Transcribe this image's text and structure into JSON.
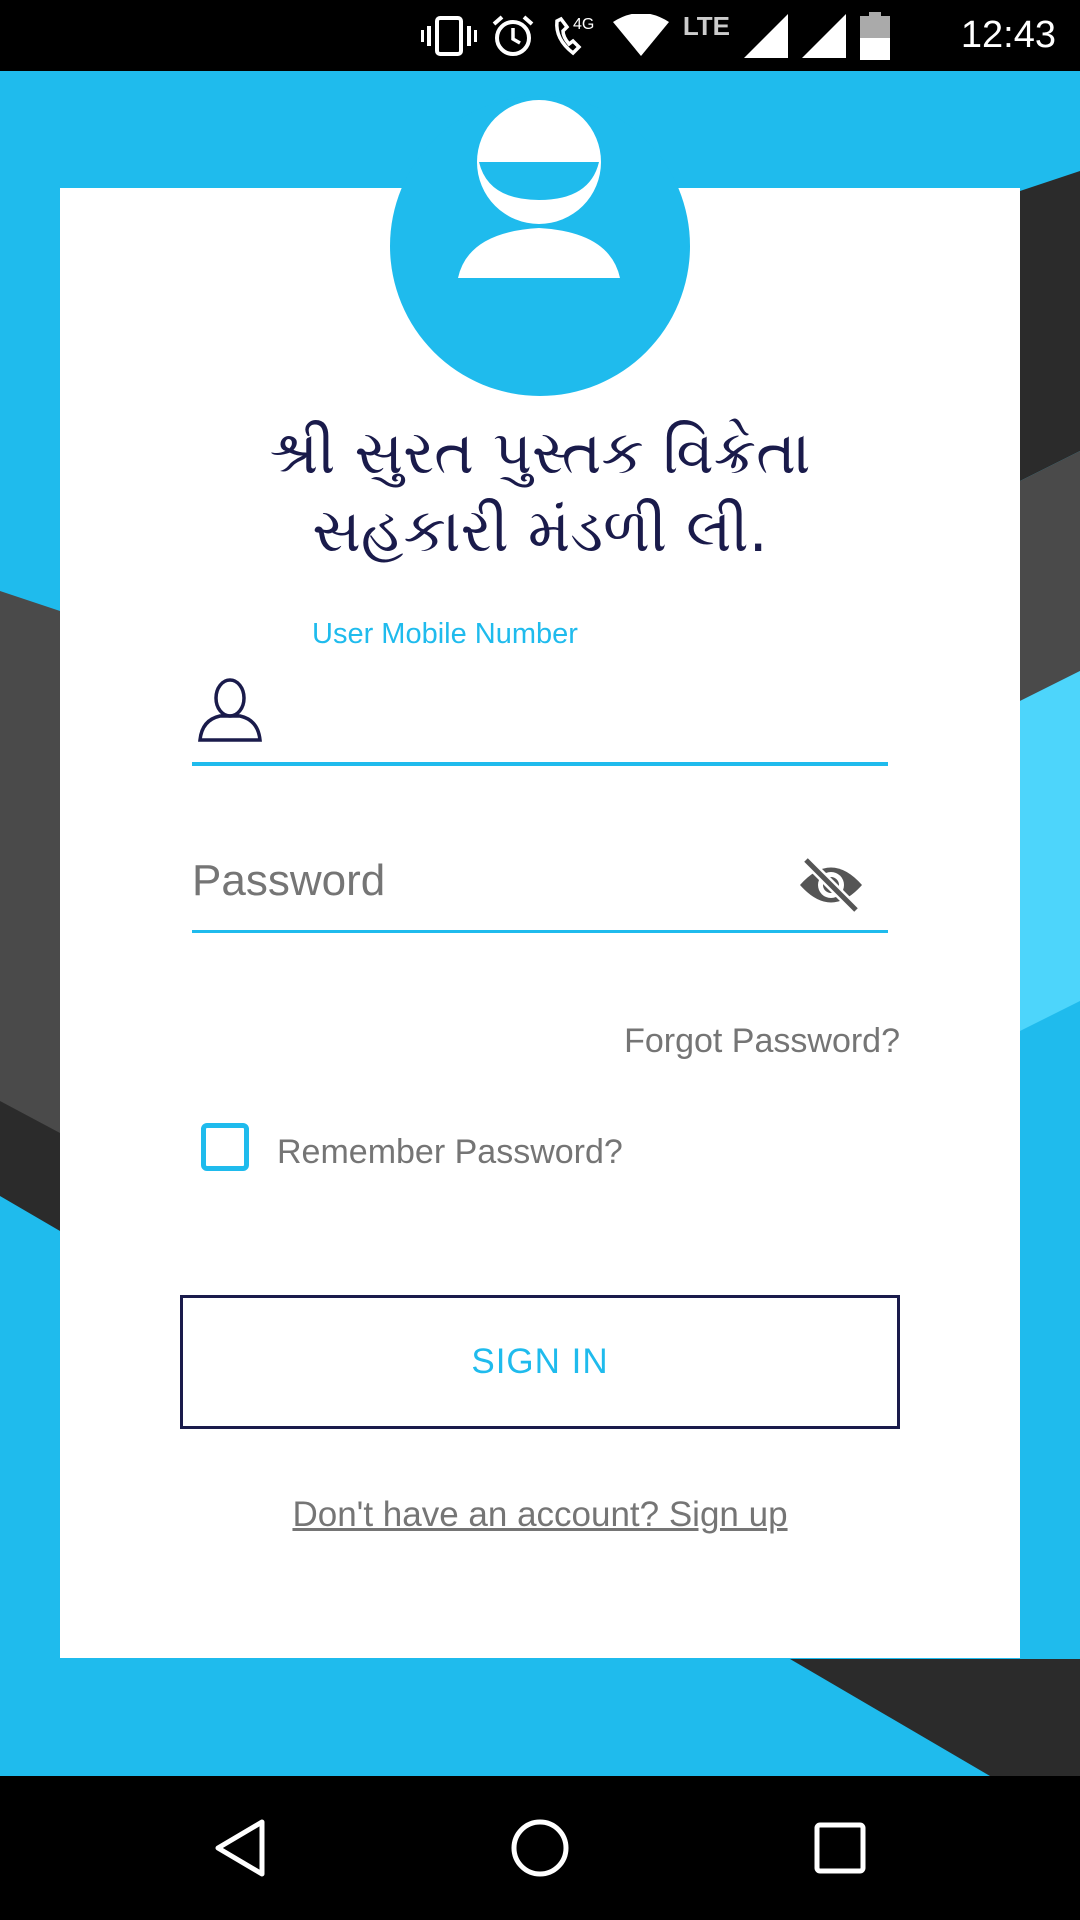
{
  "status_bar": {
    "time": "12:43",
    "network": "LTE",
    "icons": [
      "vibrate-icon",
      "alarm-icon",
      "volte-call-icon",
      "wifi-icon",
      "signal-icon",
      "signal-icon",
      "battery-icon"
    ]
  },
  "login": {
    "title_line1": "શ્રી સુરત પુસ્તક વિક્રેતા",
    "title_line2": "સહકારી મંડળી લી.",
    "mobile_label": "User Mobile Number",
    "mobile_value": "",
    "password_placeholder": "Password",
    "forgot_password": "Forgot Password?",
    "remember_password": "Remember Password?",
    "remember_checked": false,
    "sign_in": "SIGN IN",
    "sign_up": "Don't have an account? Sign up"
  },
  "colors": {
    "accent": "#1fbbed",
    "title": "#1a1b4b",
    "gray_text": "#757575",
    "stripe_dark": "#2b2b2b",
    "stripe_mid": "#4a4a4a"
  },
  "nav_bar": {
    "buttons": [
      "back-icon",
      "home-icon",
      "recents-icon"
    ]
  }
}
